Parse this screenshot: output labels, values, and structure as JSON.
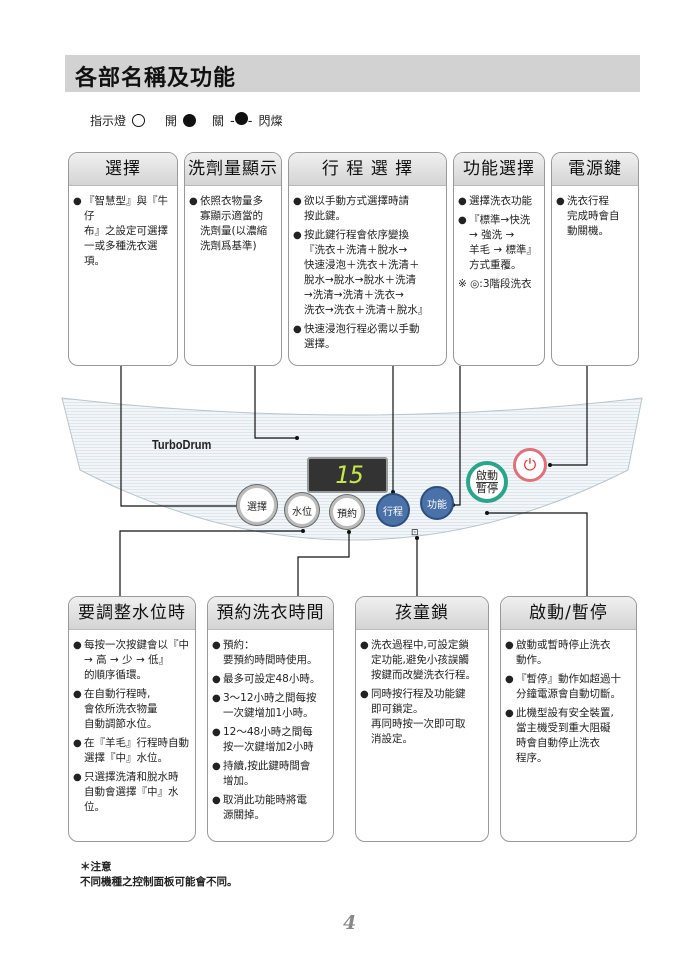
{
  "title": "各部名稱及功能",
  "legend": {
    "label": "指示燈",
    "on": "開",
    "off": "關",
    "blink": "閃燦"
  },
  "top_boxes": [
    {
      "title": "選擇",
      "items": [
        {
          "b": true,
          "t": "『智慧型』與『牛仔\n布』之設定可選擇\n一或多種洗衣選\n項。"
        }
      ]
    },
    {
      "title": "洗劑量顯示",
      "items": [
        {
          "b": true,
          "t": "依照衣物量多\n寡顯示適當的\n洗劑量(以濃縮\n洗劑爲基準)"
        }
      ]
    },
    {
      "title": "行 程 選 擇",
      "items": [
        {
          "b": true,
          "t": "欲以手動方式選擇時請\n按此鍵。"
        },
        {
          "b": true,
          "t": "按此鍵行程會依序變換\n『洗衣＋洗清＋脫水→\n快速浸泡＋洗衣＋洗清＋\n脫水→脫水→脫水＋洗清\n→洗清→洗清＋洗衣→\n洗衣→洗衣＋洗清＋脫水』"
        },
        {
          "b": true,
          "t": "快速浸泡行程必需以手動\n選擇。"
        }
      ]
    },
    {
      "title": "功能選擇",
      "items": [
        {
          "b": true,
          "t": "選擇洗衣功能"
        },
        {
          "b": true,
          "t": "『標準→快洗\n→ 強洗 →\n羊毛 → 標準』\n方式重覆。"
        },
        {
          "b": false,
          "t": "※ ◎:3階段洗衣"
        }
      ]
    },
    {
      "title": "電源鍵",
      "items": [
        {
          "b": true,
          "t": "洗衣行程\n完成時會自\n動關機。"
        }
      ]
    }
  ],
  "panel": {
    "brand": "TurboDrum",
    "display": "15",
    "buttons": {
      "select": "選擇",
      "water": "水位",
      "reserve": "預約",
      "course": "行程",
      "function": "功能",
      "start": "啟動",
      "pause": "暫停"
    }
  },
  "bottom_boxes": [
    {
      "title": "要調整水位時",
      "items": [
        {
          "b": true,
          "t": "每按一次按鍵會以『中\n→ 高 → 少 → 低』\n的順序循環。"
        },
        {
          "b": true,
          "t": "在自動行程時,\n會依所洗衣物量\n自動調節水位。"
        },
        {
          "b": true,
          "t": "在『羊毛』行程時自動\n選擇『中』水位。"
        },
        {
          "b": true,
          "t": "只選擇洗清和脫水時\n自動會選擇『中』水位。"
        }
      ]
    },
    {
      "title": "預約洗衣時間",
      "items": [
        {
          "b": true,
          "t": "預約：\n要預約時間時使用。"
        },
        {
          "b": true,
          "t": "最多可設定48小時。"
        },
        {
          "b": true,
          "t": "3～12小時之間每按\n一次鍵增加1小時。"
        },
        {
          "b": true,
          "t": "12～48小時之間每\n按一次鍵增加2小時"
        },
        {
          "b": true,
          "t": "持續,按此鍵時間會\n增加。"
        },
        {
          "b": true,
          "t": "取消此功能時將電\n源關掉。"
        }
      ]
    },
    {
      "title": "孩童鎖",
      "items": [
        {
          "b": true,
          "t": "洗衣過程中,可設定鎖\n定功能,避免小孩誤觸\n按鍵而改變洗衣行程。"
        },
        {
          "b": true,
          "t": "同時按行程及功能鍵\n即可鎖定。\n再同時按一次即可取\n消設定。"
        }
      ]
    },
    {
      "title": "啟動/暫停",
      "items": [
        {
          "b": true,
          "t": "啟動或暫時停止洗衣\n動作。"
        },
        {
          "b": true,
          "t": "『暫停』動作如超過十\n分鐘電源會自動切斷。"
        },
        {
          "b": true,
          "t": "此機型設有安全裝置,\n當主機受到重大阻礙\n時會自動停止洗衣\n程序。"
        }
      ]
    }
  ],
  "note": {
    "heading": "＊注意",
    "text": "不同機種之控制面板可能會不同。"
  },
  "page_number": "4",
  "colors": {
    "header_bg": "#d2d2d2",
    "course_button": "#4a72a8",
    "start_ring": "#2aa58a",
    "power_ring": "#e0707a",
    "display_digits": "#c6e64a"
  }
}
